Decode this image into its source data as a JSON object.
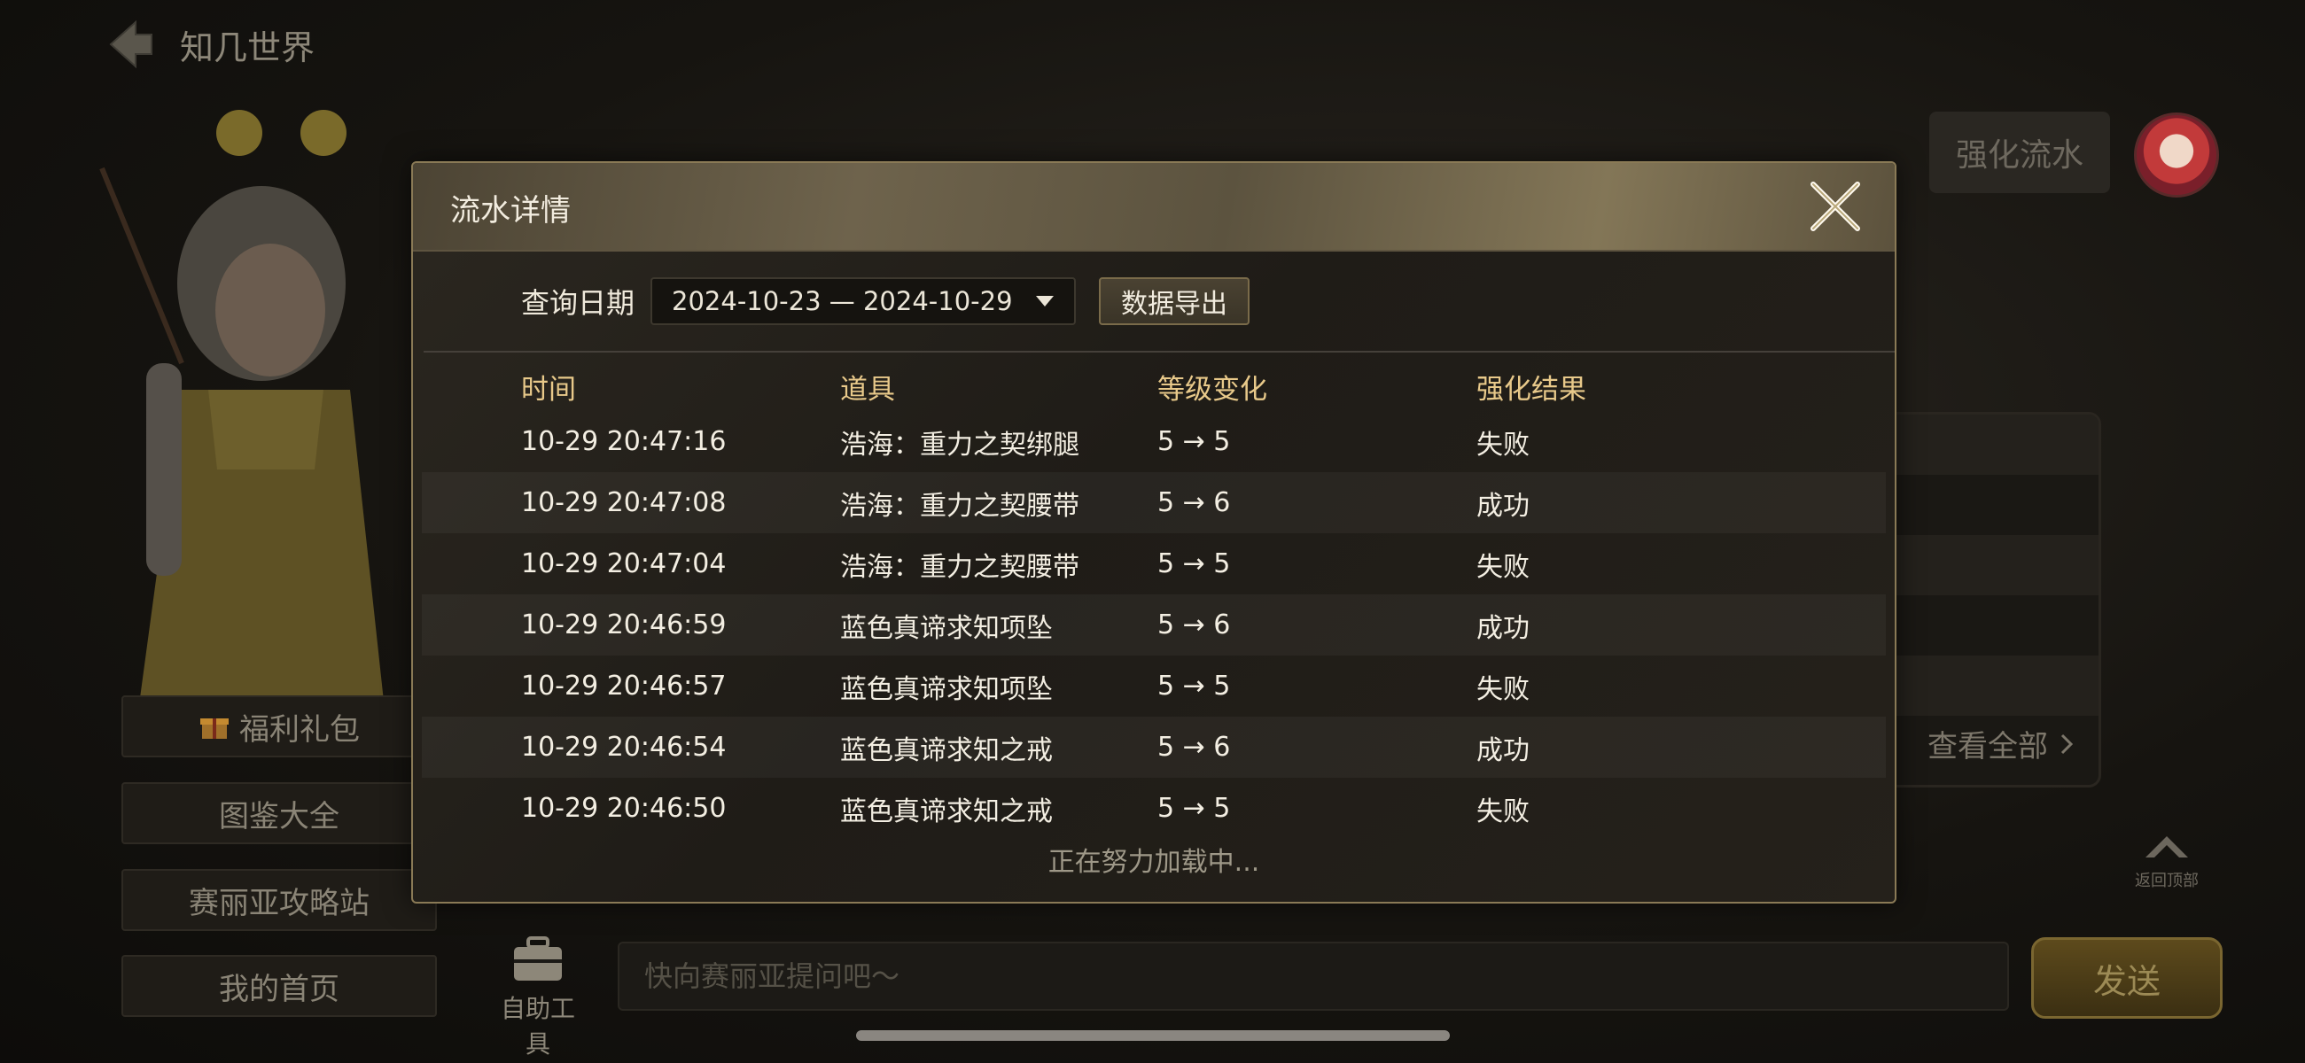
{
  "app": {
    "title": "知几世界",
    "strengthen_button": "强化流水",
    "side_buttons": [
      "福利礼包",
      "图鉴大全",
      "赛丽亚攻略站",
      "我的首页"
    ],
    "view_all": "查看全部",
    "back_to_top": "返回顶部",
    "tool_label": "自助工具",
    "ask_placeholder": "快向赛丽亚提问吧～",
    "send_button": "发送"
  },
  "modal": {
    "title": "流水详情",
    "filter_label": "查询日期",
    "date_range": "2024-10-23 — 2024-10-29",
    "export_button": "数据导出",
    "columns": [
      "时间",
      "道具",
      "等级变化",
      "强化结果"
    ],
    "rows": [
      {
        "time": "10-29 20:47:16",
        "item": "浩海：重力之契绑腿",
        "level": "5 → 5",
        "result": "失败"
      },
      {
        "time": "10-29 20:47:08",
        "item": "浩海：重力之契腰带",
        "level": "5 → 6",
        "result": "成功"
      },
      {
        "time": "10-29 20:47:04",
        "item": "浩海：重力之契腰带",
        "level": "5 → 5",
        "result": "失败"
      },
      {
        "time": "10-29 20:46:59",
        "item": "蓝色真谛求知项坠",
        "level": "5 → 6",
        "result": "成功"
      },
      {
        "time": "10-29 20:46:57",
        "item": "蓝色真谛求知项坠",
        "level": "5 → 5",
        "result": "失败"
      },
      {
        "time": "10-29 20:46:54",
        "item": "蓝色真谛求知之戒",
        "level": "5 → 6",
        "result": "成功"
      },
      {
        "time": "10-29 20:46:50",
        "item": "蓝色真谛求知之戒",
        "level": "5 → 5",
        "result": "失败"
      }
    ],
    "loading_text": "正在努力加载中..."
  },
  "colors": {
    "accent_gold": "#e8c98a",
    "modal_border": "#8a7a56"
  }
}
